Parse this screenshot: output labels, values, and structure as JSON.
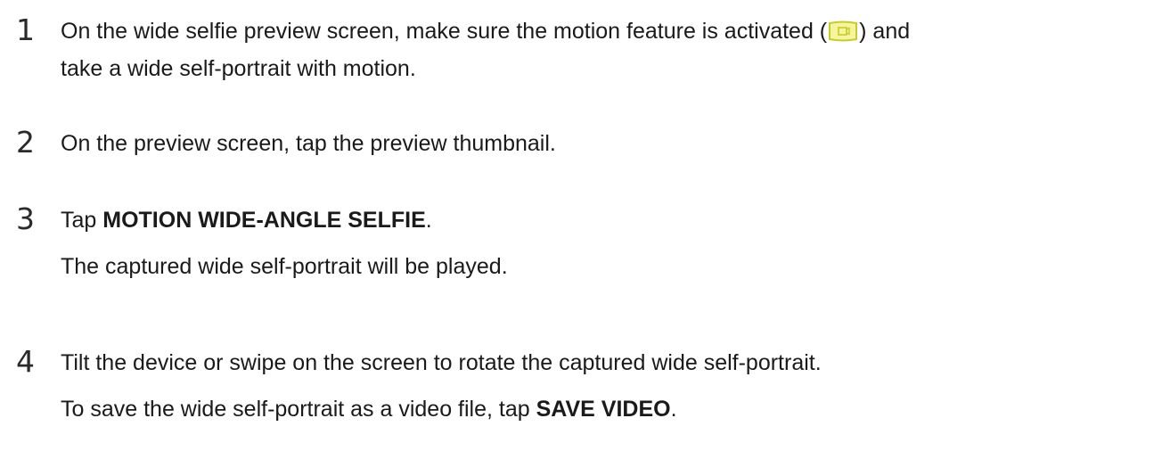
{
  "steps": [
    {
      "number": "1",
      "line1_before": "On the wide selfie preview screen, make sure the motion feature is activated (",
      "icon": "motion-wide-selfie-icon",
      "line1_after": ") and",
      "line2": "take a wide self-portrait with motion."
    },
    {
      "number": "2",
      "text": "On the preview screen, tap the preview thumbnail."
    },
    {
      "number": "3",
      "prefix": "Tap ",
      "bold": "MOTION WIDE-ANGLE SELFIE",
      "suffix": ".",
      "note": "The captured wide self-portrait will be played."
    },
    {
      "number": "4",
      "text": "Tilt the device or swipe on the screen to rotate the captured wide self-portrait.",
      "note_prefix": "To save the wide self-portrait as a video file, tap ",
      "note_bold": "SAVE VIDEO",
      "note_suffix": "."
    }
  ],
  "colors": {
    "text": "#1a1a1a",
    "icon_fill": "#f4f59c",
    "icon_stroke": "#c8cc2a"
  }
}
